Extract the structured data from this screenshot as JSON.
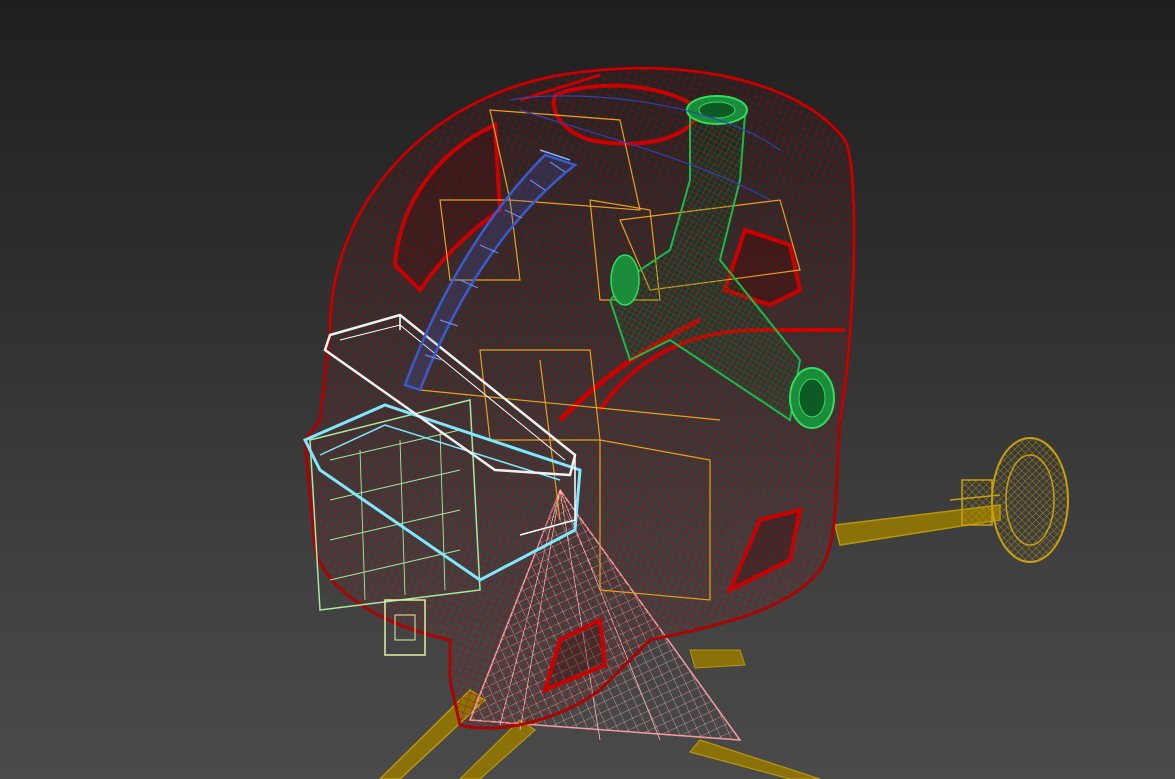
{
  "viewport": {
    "colors": {
      "background_top": "#1f1f1f",
      "background_bottom": "#4a4a4a",
      "shell_wire": "#8b0000",
      "shell_fill": "#8b1010",
      "pipe_green": "#1db84a",
      "blue_part": "#3a5ad0",
      "cyan_part": "#7fe8ff",
      "white_part": "#f0f0f0",
      "orange_box": "#e8a020",
      "pink_cone": "#ff9aa0",
      "gold_handle": "#b8960c",
      "light_green_box": "#a8e8a0"
    }
  }
}
